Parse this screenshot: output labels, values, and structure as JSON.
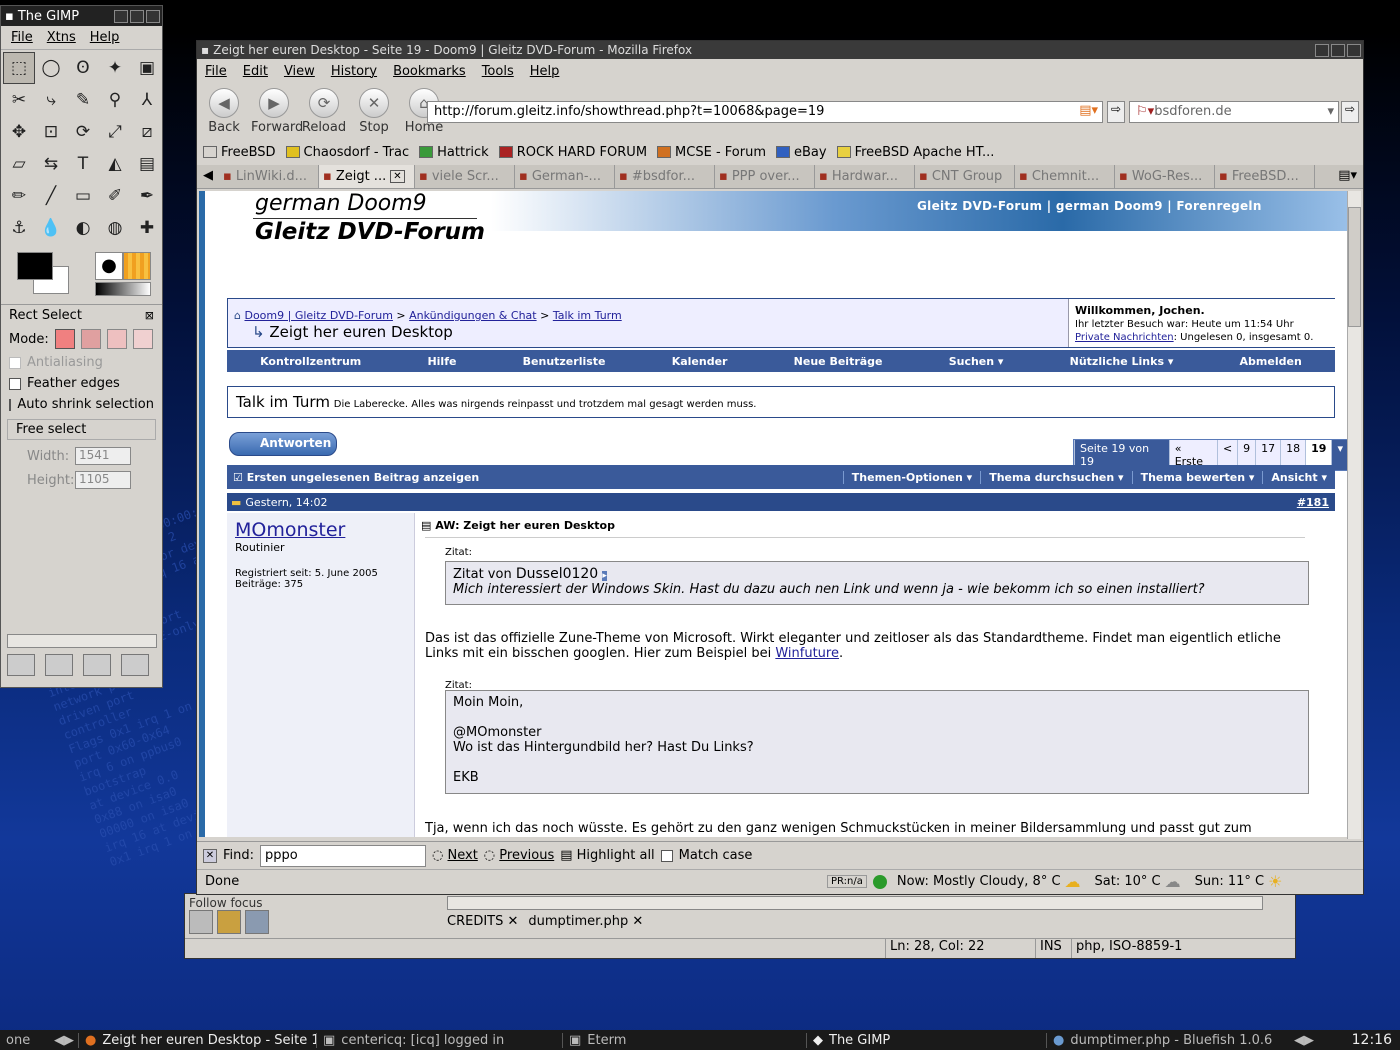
{
  "desktop": {
    "bg_text": [
      "1000 at device 11.0",
      "ACPI: PCI Interrupt 0000:00:1f.2",
      "ich5: chipset revision 2",
      "ACPI: PCI interrupt for device",
      "00:01:41:c7:92:2f irq 16 at device",
      "10baseT port",
      "compatible COM port",
      "parallel printer port",
      "PnP device (NIBBLE-only)",
      "interface",
      "network port",
      "driven port",
      "controller",
      "Flags 0x1 irq 1 on atkbd0",
      "port 0x60-0x64",
      "irq 6 on ppbus0",
      "bootstrap",
      "at device 0.0",
      "0x88 on isa0",
      "00000 on isa0",
      "irq 16 at device 0.0",
      "0x1 irq 1 on atkbd0"
    ]
  },
  "gimp": {
    "title": "The GIMP",
    "menu": [
      "File",
      "Xtns",
      "Help"
    ],
    "tools": [
      "rect-select",
      "ellipse-select",
      "free-select",
      "fuzzy-select",
      "by-color-select",
      "scissors",
      "paths",
      "color-picker",
      "zoom",
      "measure",
      "move",
      "crop",
      "rotate",
      "scale",
      "shear",
      "perspective",
      "flip",
      "text",
      "bucket-fill",
      "blend",
      "pencil",
      "paintbrush",
      "eraser",
      "airbrush",
      "ink",
      "clone",
      "smudge",
      "dodge",
      "convolve",
      "heal"
    ],
    "tool_glyphs": [
      "⬚",
      "◯",
      "ʘ",
      "✦",
      "▣",
      "✂",
      "⤷",
      "✎",
      "⚲",
      "⅄",
      "✥",
      "⊡",
      "⟳",
      "⤢",
      "⧄",
      "▱",
      "⇆",
      "T",
      "◭",
      "▤",
      "✏",
      "╱",
      "▭",
      "✐",
      "✒",
      "⚓",
      "💧",
      "◐",
      "◍",
      "✚"
    ],
    "opts_title": "Rect Select",
    "mode_label": "Mode:",
    "antialiasing": "Antialiasing",
    "feather": "Feather edges",
    "autoshrink": "Auto shrink selection",
    "freeselect": "Free select",
    "width_label": "Width:",
    "width_val": "1541",
    "height_label": "Height:",
    "height_val": "1105"
  },
  "firefox": {
    "title": "Zeigt her euren Desktop - Seite 19 - Doom9 | Gleitz DVD-Forum - Mozilla Firefox",
    "menu": [
      "File",
      "Edit",
      "View",
      "History",
      "Bookmarks",
      "Tools",
      "Help"
    ],
    "nav": [
      "Back",
      "Forward",
      "Reload",
      "Stop",
      "Home"
    ],
    "nav_icons": [
      "◀",
      "▶",
      "⟳",
      "✕",
      "⌂"
    ],
    "url": "http://forum.gleitz.info/showthread.php?t=10068&page=19",
    "search": "bsdforen.de",
    "bookmarks": [
      {
        "label": "FreeBSD",
        "color": "#d6d3ce"
      },
      {
        "label": "Chaosdorf - Trac",
        "color": "#e0c020"
      },
      {
        "label": "Hattrick",
        "color": "#3a9a3a"
      },
      {
        "label": "ROCK HARD FORUM",
        "color": "#aa2222"
      },
      {
        "label": "MCSE - Forum",
        "color": "#d07020"
      },
      {
        "label": "eBay",
        "color": "#3060c0"
      },
      {
        "label": "FreeBSD Apache HT...",
        "color": "#e8d040"
      }
    ],
    "tabs": [
      "LinWiki.d...",
      "Zeigt ...",
      "viele Scr...",
      "German-...",
      "#bsdfor...",
      "PPP over...",
      "Hardwar...",
      "CNT Group",
      "Chemnit...",
      "WoG-Res...",
      "FreeBSD..."
    ],
    "find_label": "Find:",
    "find_value": "pppo",
    "find_next": "Next",
    "find_prev": "Previous",
    "find_highlight": "Highlight all",
    "find_match": "Match case",
    "status": "Done",
    "pr": "PR:n/a",
    "weather_now": "Now: Mostly Cloudy, 8° C",
    "weather_sat": "Sat: 10° C",
    "weather_sun": "Sun: 11° C"
  },
  "forum": {
    "logo_top": "german Doom9",
    "logo_bottom": "Gleitz DVD-Forum",
    "banner_nav": "Gleitz DVD-Forum  |  german Doom9  |  Forenregeln",
    "breadcrumb": [
      "Doom9 | Gleitz DVD-Forum",
      "Ankündigungen & Chat",
      "Talk im Turm"
    ],
    "thread_title": "Zeigt her euren Desktop",
    "welcome": "Willkommen, Jochen.",
    "last_visit": "Ihr letzter Besuch war: Heute um 11:54 Uhr",
    "pm_link": "Private Nachrichten",
    "pm_text": ": Ungelesen 0, insgesamt 0.",
    "navbar": [
      "Kontrollzentrum",
      "Hilfe",
      "Benutzerliste",
      "Kalender",
      "Neue Beiträge",
      "Suchen ▾",
      "Nützliche Links ▾",
      "Abmelden"
    ],
    "forum_name": "Talk im Turm",
    "forum_desc": "Die Laberecke. Alles was nirgends reinpasst und trotzdem mal gesagt werden muss.",
    "reply_btn": "Antworten",
    "pagination": [
      "Seite 19 von 19",
      "« Erste",
      "<",
      "9",
      "17",
      "18",
      "19",
      "▾"
    ],
    "threadtools": [
      "Ersten ungelesenen Beitrag anzeigen",
      "Themen-Optionen ▾",
      "Thema durchsuchen ▾",
      "Thema bewerten ▾",
      "Ansicht ▾"
    ],
    "post_date": "Gestern, 14:02",
    "post_num": "#181",
    "username": "MOmonster",
    "usertitle": "Routinier",
    "registered": "Registriert seit: 5. June 2005",
    "posts": "Beiträge: 375",
    "post_title": "AW: Zeigt her euren Desktop",
    "zitat": "Zitat:",
    "quote1_prefix": "Zitat von",
    "quote1_author": "Dussel0120",
    "quote1_text": "Mich interessiert der Windows Skin. Hast du dazu auch nen Link und wenn ja - wie bekomm ich so einen installiert?",
    "body1": "Das ist das offizielle Zune-Theme von Microsoft. Wirkt eleganter und zeitloser als das Standardtheme. Findet man eigentlich etliche Links mit ein bisschen googlen. Hier zum Beispiel bei",
    "body1_link": "Winfuture",
    "zitat2": "Zitat:",
    "quote2_lines": [
      "Moin Moin,",
      "",
      "@MOmonster",
      "Wo ist das Hintergundbild her? Hast Du Links?",
      "",
      "EKB"
    ],
    "body2": "Tja, wenn ich das noch wüsste. Es gehört zu den ganz wenigen Schmuckstücken in meiner Bildersammlung und passt gut zum"
  },
  "bluefish": {
    "tabs": [
      "CREDITS",
      "dumptimer.php"
    ],
    "follow": "Follow focus",
    "ln": "Ln: 28, Col: 22",
    "ins": "INS",
    "enc": "php, ISO-8859-1"
  },
  "taskbar": {
    "desk": "one",
    "tasks": [
      "Zeigt her euren Desktop - Seite 19",
      "centericq: [icq] logged in",
      "Eterm",
      "The GIMP",
      "dumptimer.php - Bluefish 1.0.6"
    ],
    "clock": "12:16"
  }
}
